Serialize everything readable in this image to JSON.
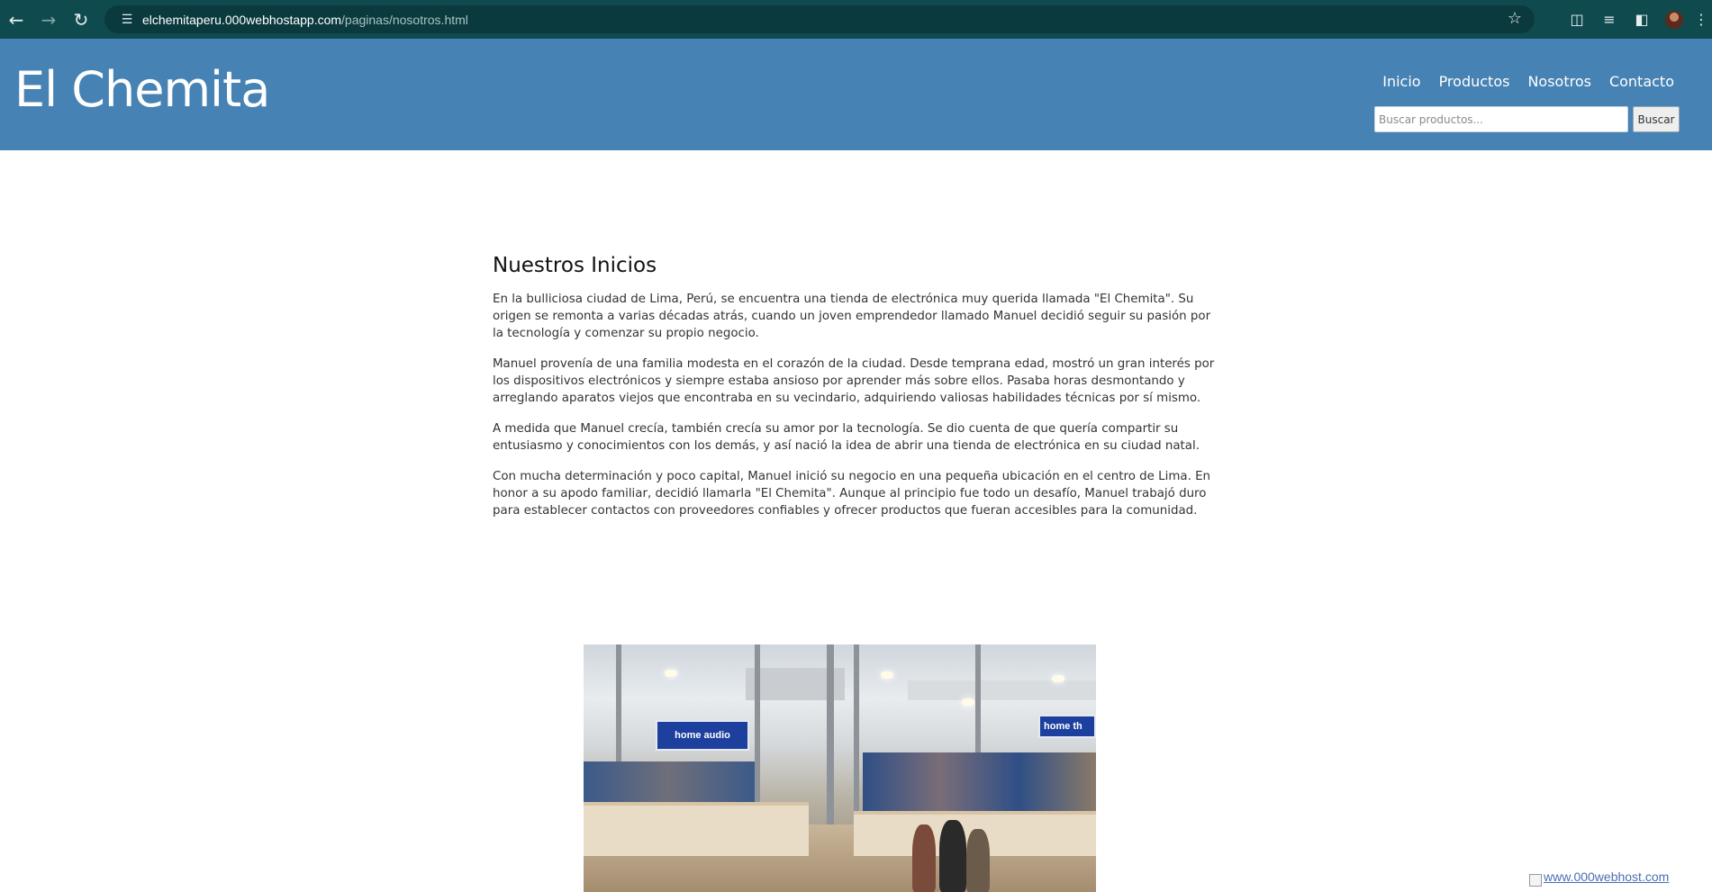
{
  "browser": {
    "url_host": "elchemitaperu.000webhostapp.com",
    "url_path": "/paginas/nosotros.html"
  },
  "site": {
    "brand": "El Chemita",
    "nav": [
      {
        "label": "Inicio"
      },
      {
        "label": "Productos"
      },
      {
        "label": "Nosotros"
      },
      {
        "label": "Contacto"
      }
    ],
    "search": {
      "placeholder": "Buscar productos...",
      "button_label": "Buscar"
    }
  },
  "article": {
    "title": "Nuestros Inicios",
    "paragraphs": [
      "En la bulliciosa ciudad de Lima, Perú, se encuentra una tienda de electrónica muy querida llamada \"El Chemita\". Su origen se remonta a varias décadas atrás, cuando un joven emprendedor llamado Manuel decidió seguir su pasión por la tecnología y comenzar su propio negocio.",
      "Manuel provenía de una familia modesta en el corazón de la ciudad. Desde temprana edad, mostró un gran interés por los dispositivos electrónicos y siempre estaba ansioso por aprender más sobre ellos. Pasaba horas desmontando y arreglando aparatos viejos que encontraba en su vecindario, adquiriendo valiosas habilidades técnicas por sí mismo.",
      "A medida que Manuel crecía, también crecía su amor por la tecnología. Se dio cuenta de que quería compartir su entusiasmo y conocimientos con los demás, y así nació la idea de abrir una tienda de electrónica en su ciudad natal.",
      "Con mucha determinación y poco capital, Manuel inició su negocio en una pequeña ubicación en el centro de Lima. En honor a su apodo familiar, decidió llamarla \"El Chemita\". Aunque al principio fue todo un desafío, Manuel trabajó duro para establecer contactos con proveedores confiables y ofrecer productos que fueran accesibles para la comunidad."
    ],
    "photo_signs": [
      "home audio",
      "home th"
    ]
  },
  "footer": {
    "host_badge": "www.000webhost.com"
  }
}
